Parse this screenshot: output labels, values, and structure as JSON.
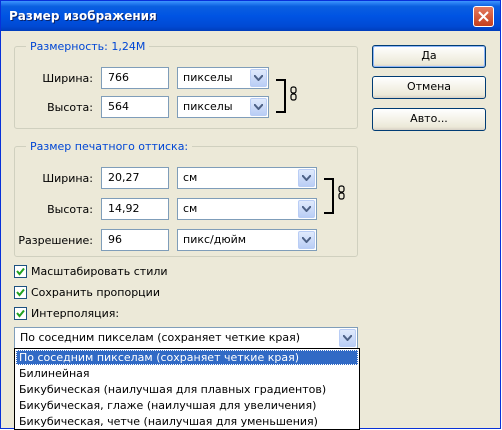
{
  "window": {
    "title": "Размер изображения"
  },
  "pixel_dimensions": {
    "legend": "Размерность:  1,24M",
    "width_label": "Ширина:",
    "width_value": "766",
    "width_unit": "пикселы",
    "height_label": "Высота:",
    "height_value": "564",
    "height_unit": "пикселы"
  },
  "document_size": {
    "legend": "Размер печатного оттиска:",
    "width_label": "Ширина:",
    "width_value": "20,27",
    "width_unit": "см",
    "height_label": "Высота:",
    "height_value": "14,92",
    "height_unit": "см",
    "resolution_label": "Разрешение:",
    "resolution_value": "96",
    "resolution_unit": "пикс/дюйм"
  },
  "buttons": {
    "ok": "Да",
    "cancel": "Отмена",
    "auto": "Авто..."
  },
  "options": {
    "scale_styles": {
      "label": "Масштабировать стили",
      "checked": true
    },
    "constrain_proportions": {
      "label": "Сохранить пропорции",
      "checked": true
    },
    "resample": {
      "label": "Интерполяция:",
      "checked": true
    }
  },
  "resample_method": {
    "selected": "По соседним пикселам (сохраняет четкие края)",
    "options": [
      "По соседним пикселам (сохраняет четкие края)",
      "Билинейная",
      "Бикубическая (наилучшая для плавных градиентов)",
      "Бикубическая, глаже (наилучшая для увеличения)",
      "Бикубическая, четче (наилучшая для уменьшения)"
    ]
  },
  "icons": {
    "close": "close-icon",
    "dropdown": "chevron-down-icon",
    "link": "chain-link-icon",
    "check": "checkmark-icon"
  },
  "colors": {
    "titlebar": "#0054e3",
    "legend_text": "#0046d5",
    "selection": "#316ac5",
    "dialog_bg": "#ece9d8"
  }
}
